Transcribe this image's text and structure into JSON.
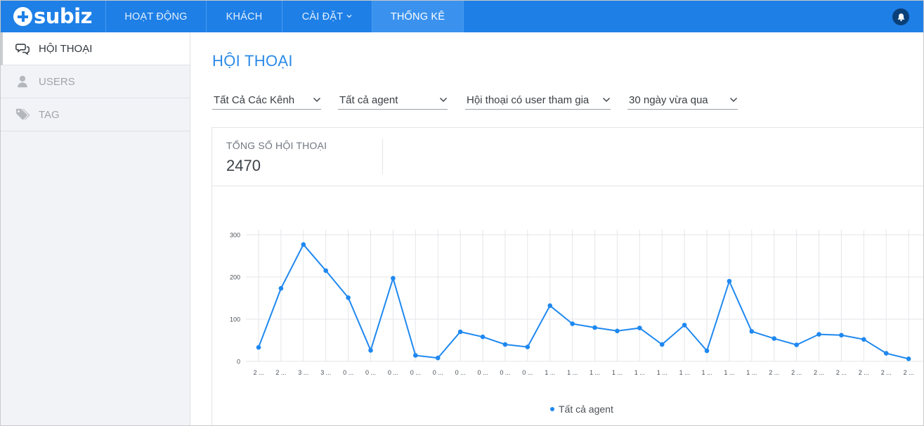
{
  "app": {
    "logo_text": "subiz",
    "accent": "#1e7fe6"
  },
  "nav": {
    "items": [
      {
        "label": "HOẠT ĐỘNG"
      },
      {
        "label": "KHÁCH"
      },
      {
        "label": "CÀI ĐẶT",
        "caret": "˅"
      },
      {
        "label": "THỐNG KÊ",
        "active": true
      }
    ],
    "bell_icon": "bell-icon"
  },
  "sidebar": {
    "items": [
      {
        "label": "HỘI THOẠI",
        "icon": "chat-bubbles-icon",
        "active": true
      },
      {
        "label": "USERS",
        "icon": "user-icon"
      },
      {
        "label": "TAG",
        "icon": "tags-icon"
      }
    ]
  },
  "main": {
    "title": "HỘI THOẠI",
    "filters": [
      {
        "value": "Tất Cả Các Kênh"
      },
      {
        "value": "Tất cả agent"
      },
      {
        "value": "Hội thoại có user tham gia"
      },
      {
        "value": "30 ngày vừa qua"
      }
    ],
    "stat": {
      "label": "TỔNG SỐ HỘI THOẠI",
      "value": "2470"
    }
  },
  "chart_data": {
    "type": "line",
    "x": [
      "2 ...",
      "2 ...",
      "3 ...",
      "3 ...",
      "0 ...",
      "0 ...",
      "0 ...",
      "0 ...",
      "0 ...",
      "0 ...",
      "0 ...",
      "0 ...",
      "0 ...",
      "1 ...",
      "1 ...",
      "1 ...",
      "1 ...",
      "1 ...",
      "1 ...",
      "1 ...",
      "1 ...",
      "1 ...",
      "1 ...",
      "2 ...",
      "2 ...",
      "2 ...",
      "2 ...",
      "2 ...",
      "2 ...",
      "2 ..."
    ],
    "series": [
      {
        "name": "Tất cả agent",
        "color": "#1e88f0",
        "values": [
          33,
          173,
          277,
          215,
          151,
          26,
          197,
          14,
          8,
          70,
          58,
          40,
          34,
          132,
          89,
          80,
          72,
          79,
          40,
          86,
          25,
          190,
          71,
          54,
          39,
          64,
          62,
          52,
          19,
          6
        ]
      }
    ],
    "yticks": [
      0,
      100,
      200,
      300
    ],
    "ylim": [
      0,
      300
    ],
    "grid": true,
    "legend": "bottom"
  }
}
